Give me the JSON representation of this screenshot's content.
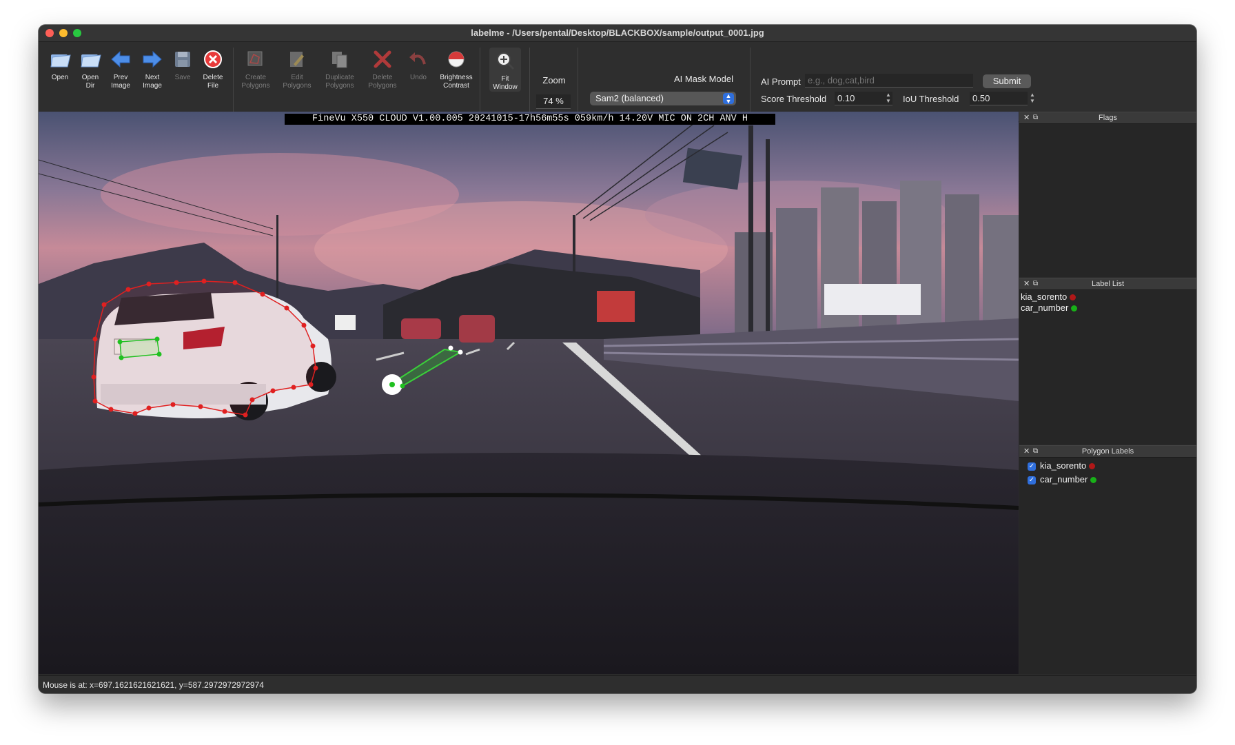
{
  "window": {
    "title": "labelme - /Users/pental/Desktop/BLACKBOX/sample/output_0001.jpg"
  },
  "toolbar": {
    "tools": [
      {
        "id": "open",
        "label": "Open",
        "icon": "folder-open-icon",
        "enabled": true
      },
      {
        "id": "open-dir",
        "label": "Open\nDir",
        "icon": "folder-open-icon",
        "enabled": true
      },
      {
        "id": "prev-image",
        "label": "Prev\nImage",
        "icon": "arrow-left-icon",
        "enabled": true
      },
      {
        "id": "next-image",
        "label": "Next\nImage",
        "icon": "arrow-right-icon",
        "enabled": true
      },
      {
        "id": "save",
        "label": "Save",
        "icon": "floppy-disk-icon",
        "enabled": false
      },
      {
        "id": "delete-file",
        "label": "Delete\nFile",
        "icon": "delete-circle-icon",
        "enabled": true
      },
      {
        "id": "create-polygons",
        "label": "Create\nPolygons",
        "icon": "create-polygon-icon",
        "enabled": false
      },
      {
        "id": "edit-polygons",
        "label": "Edit\nPolygons",
        "icon": "edit-pencil-icon",
        "enabled": false
      },
      {
        "id": "duplicate-polygons",
        "label": "Duplicate\nPolygons",
        "icon": "duplicate-icon",
        "enabled": false
      },
      {
        "id": "delete-polygons",
        "label": "Delete\nPolygons",
        "icon": "delete-x-icon",
        "enabled": false
      },
      {
        "id": "undo",
        "label": "Undo",
        "icon": "undo-icon",
        "enabled": false
      },
      {
        "id": "brightness-contrast",
        "label": "Brightness\nContrast",
        "icon": "brightness-icon",
        "enabled": true
      },
      {
        "id": "fit-window",
        "label": "Fit\nWindow",
        "icon": "fit-window-icon",
        "enabled": true
      }
    ],
    "zoom_label": "Zoom",
    "zoom_value": "74 %",
    "ai_model_label": "AI Mask Model",
    "ai_model_selected": "Sam2 (balanced)",
    "ai_prompt_label": "AI Prompt",
    "ai_prompt_placeholder": "e.g., dog,cat,bird",
    "submit_label": "Submit",
    "score_threshold_label": "Score Threshold",
    "score_threshold_value": "0.10",
    "iou_threshold_label": "IoU Threshold",
    "iou_threshold_value": "0.50"
  },
  "canvas": {
    "overlay_text": "FineVu X550 CLOUD V1.00.005 20241015-17h56m55s 059km/h 14.20V MIC  ON 2CH ANV H",
    "polygon_colors": {
      "kia_sorento": "#e02020",
      "car_number": "#20c020"
    }
  },
  "panels": {
    "flags": {
      "title": "Flags"
    },
    "label_list": {
      "title": "Label List",
      "items": [
        {
          "label": "kia_sorento",
          "color": "#e02020"
        },
        {
          "label": "car_number",
          "color": "#20c020"
        }
      ]
    },
    "polygon_labels": {
      "title": "Polygon Labels",
      "items": [
        {
          "label": "kia_sorento",
          "color": "#e02020",
          "checked": true
        },
        {
          "label": "car_number",
          "color": "#20c020",
          "checked": true
        }
      ]
    }
  },
  "status": {
    "text": "Mouse is at: x=697.1621621621621, y=587.2972972972974"
  }
}
